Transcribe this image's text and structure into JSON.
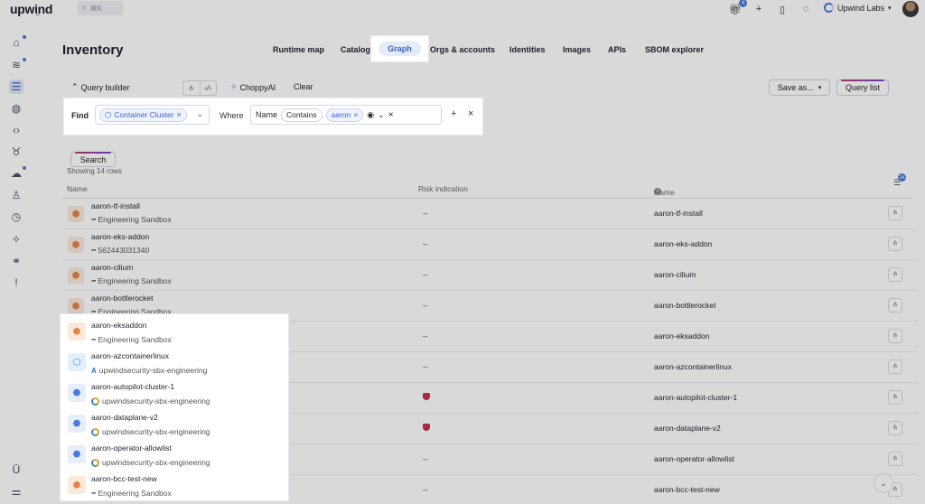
{
  "app": {
    "logo": "upwind",
    "search_hint": "⌘K",
    "notification_count": "4",
    "org_name": "Upwind Labs"
  },
  "page": {
    "title": "Inventory"
  },
  "tabs": [
    {
      "label": "Runtime map"
    },
    {
      "label": "Catalog"
    },
    {
      "label": "Graph"
    },
    {
      "label": "Orgs & accounts"
    },
    {
      "label": "Identities"
    },
    {
      "label": "Images"
    },
    {
      "label": "APIs"
    },
    {
      "label": "SBOM explorer"
    }
  ],
  "toolbar": {
    "query_builder": "Query builder",
    "choppy": "ChoppyAI",
    "clear": "Clear",
    "save_as": "Save as...",
    "query_list": "Query list"
  },
  "query": {
    "find_label": "Find",
    "find_value": "Container Cluster",
    "where_label": "Where",
    "field": "Name",
    "operator": "Contains",
    "value": "aaron",
    "search_label": "Search"
  },
  "table": {
    "showing": "Showing 14 rows",
    "columns": [
      "Name",
      "Risk indication",
      "Name"
    ],
    "column_count_badge": "24",
    "rows": [
      {
        "name": "aaron-tf-install",
        "account": "Engineering Sandbox",
        "provider": "eng",
        "risk": "--",
        "name2": "aaron-tf-install",
        "icon": "orange"
      },
      {
        "name": "aaron-eks-addon",
        "account": "562443031340",
        "provider": "eng",
        "risk": "--",
        "name2": "aaron-eks-addon",
        "icon": "orange"
      },
      {
        "name": "aaron-cilium",
        "account": "Engineering Sandbox",
        "provider": "eng",
        "risk": "--",
        "name2": "aaron-cilium",
        "icon": "orange"
      },
      {
        "name": "aaron-bottlerocket",
        "account": "Engineering Sandbox",
        "provider": "eng",
        "risk": "--",
        "name2": "aaron-bottlerocket",
        "icon": "orange"
      },
      {
        "name": "aaron-eksaddon",
        "account": "Engineering Sandbox",
        "provider": "eng",
        "risk": "--",
        "name2": "aaron-eksaddon",
        "icon": "orange"
      },
      {
        "name": "aaron-azcontainerlinux",
        "account": "upwindsecurity-sbx-engineering",
        "provider": "az",
        "risk": "--",
        "name2": "aaron-azcontainerlinux",
        "icon": "blue"
      },
      {
        "name": "aaron-autopilot-cluster-1",
        "account": "upwindsecurity-sbx-engineering",
        "provider": "gcp",
        "risk": "shield",
        "name2": "aaron-autopilot-cluster-1",
        "icon": "gblue"
      },
      {
        "name": "aaron-dataplane-v2",
        "account": "upwindsecurity-sbx-engineering",
        "provider": "gcp",
        "risk": "shield",
        "name2": "aaron-dataplane-v2",
        "icon": "gblue"
      },
      {
        "name": "aaron-operator-allowlist",
        "account": "upwindsecurity-sbx-engineering",
        "provider": "gcp",
        "risk": "--",
        "name2": "aaron-operator-allowlist",
        "icon": "gblue"
      },
      {
        "name": "aaron-bcc-test-new",
        "account": "Engineering Sandbox",
        "provider": "eng",
        "risk": "--",
        "name2": "aaron-bcc-test-new",
        "icon": "orange"
      }
    ]
  },
  "colors": {
    "accent": "#3a66c6",
    "risk_high": "#c9324b"
  },
  "icons": [
    "home-icon",
    "activity-icon",
    "inventory-icon",
    "globe-icon",
    "code-icon",
    "bug-icon",
    "cloud-icon",
    "user-icon",
    "clock-icon",
    "sparkle-icon",
    "share-icon",
    "alert-icon",
    "upwind-icon",
    "sliders-icon"
  ]
}
